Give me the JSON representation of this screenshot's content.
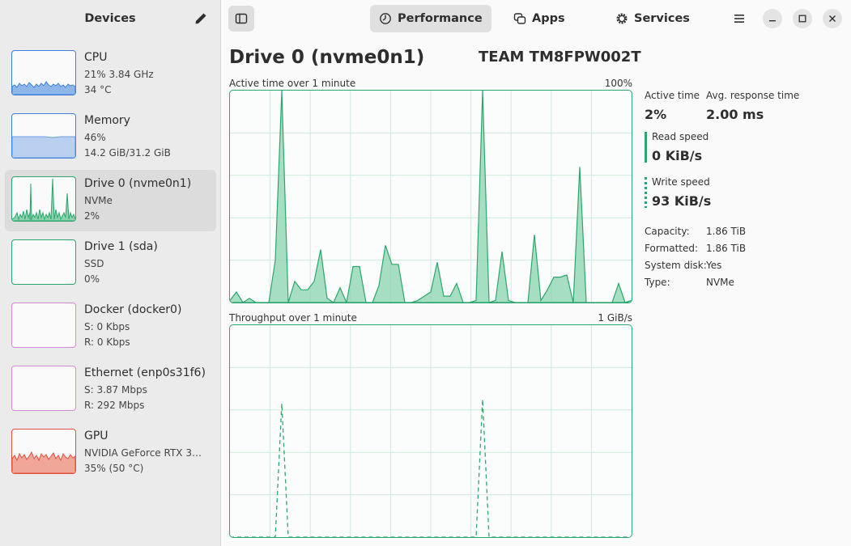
{
  "sidebar": {
    "title": "Devices",
    "devices": [
      {
        "name": "CPU",
        "line1": "21% 3.84 GHz",
        "line2": "34 °C"
      },
      {
        "name": "Memory",
        "line1": "46%",
        "line2": "14.2 GiB/31.2 GiB"
      },
      {
        "name": "Drive 0 (nvme0n1)",
        "line1": "NVMe",
        "line2": "2%"
      },
      {
        "name": "Drive 1 (sda)",
        "line1": "SSD",
        "line2": "0%"
      },
      {
        "name": "Docker (docker0)",
        "line1": "S: 0 Kbps",
        "line2": "R: 0 Kbps"
      },
      {
        "name": "Ethernet (enp0s31f6)",
        "line1": "S: 3.87 Mbps",
        "line2": "R: 292 Mbps"
      },
      {
        "name": "GPU",
        "line1": "NVIDIA GeForce RTX 30…",
        "line2": "35% (50 °C)"
      }
    ]
  },
  "header": {
    "tabs": [
      {
        "label": "Performance",
        "icon": "gauge-icon",
        "active": true
      },
      {
        "label": "Apps",
        "icon": "apps-icon",
        "active": false
      },
      {
        "label": "Services",
        "icon": "gear-icon",
        "active": false
      }
    ]
  },
  "main": {
    "title": "Drive 0 (nvme0n1)",
    "model": "TEAM TM8FPW002T",
    "active_graph": {
      "label": "Active time over 1 minute",
      "max": "100%"
    },
    "throughput_graph": {
      "label": "Throughput over 1 minute",
      "max": "1 GiB/s"
    },
    "stats": {
      "active_time_label": "Active time",
      "active_time_value": "2%",
      "response_label": "Avg. response time",
      "response_value": "2.00 ms",
      "read_label": "Read speed",
      "read_value": "0 KiB/s",
      "write_label": "Write speed",
      "write_value": "93 KiB/s"
    },
    "info": [
      {
        "key": "Capacity:",
        "value": "1.86 TiB"
      },
      {
        "key": "Formatted:",
        "value": "1.86 TiB"
      },
      {
        "key": "System disk:",
        "value": "Yes"
      },
      {
        "key": "Type:",
        "value": "NVMe"
      }
    ]
  },
  "colors": {
    "drive_green": "#2ea56e",
    "cpu_blue": "#3d7fd9",
    "network_purple": "#d988d9",
    "gpu_red": "#e0503c"
  },
  "chart_data": [
    {
      "type": "area",
      "title": "Active time over 1 minute",
      "ylim": [
        0,
        100
      ],
      "unit": "%",
      "series": [
        {
          "values": [
            1,
            5,
            0,
            2,
            0,
            0,
            0,
            20,
            100,
            0,
            10,
            6,
            6,
            10,
            25,
            2,
            0,
            7,
            0,
            17,
            17,
            0,
            0,
            8,
            27,
            18,
            18,
            0,
            0,
            1,
            3,
            5,
            19,
            3,
            3,
            9,
            0,
            0,
            1,
            100,
            0,
            1,
            24,
            1,
            0,
            0,
            0,
            32,
            1,
            6,
            12,
            12,
            13,
            0,
            64,
            0,
            0,
            0,
            0,
            0,
            9,
            0,
            1
          ]
        }
      ]
    },
    {
      "type": "line",
      "title": "Throughput over 1 minute",
      "ylim": [
        0,
        1
      ],
      "unit": "GiB/s",
      "series": [
        {
          "values": [
            0,
            0,
            0,
            0,
            0,
            0,
            0,
            0,
            0.63,
            0,
            0,
            0,
            0,
            0,
            0,
            0,
            0,
            0,
            0,
            0,
            0,
            0,
            0,
            0,
            0,
            0,
            0,
            0,
            0,
            0,
            0,
            0,
            0,
            0,
            0,
            0,
            0,
            0,
            0,
            0.65,
            0,
            0,
            0,
            0,
            0,
            0,
            0,
            0,
            0,
            0,
            0,
            0,
            0,
            0,
            0,
            0,
            0,
            0,
            0,
            0,
            0,
            0,
            0
          ]
        }
      ]
    }
  ]
}
